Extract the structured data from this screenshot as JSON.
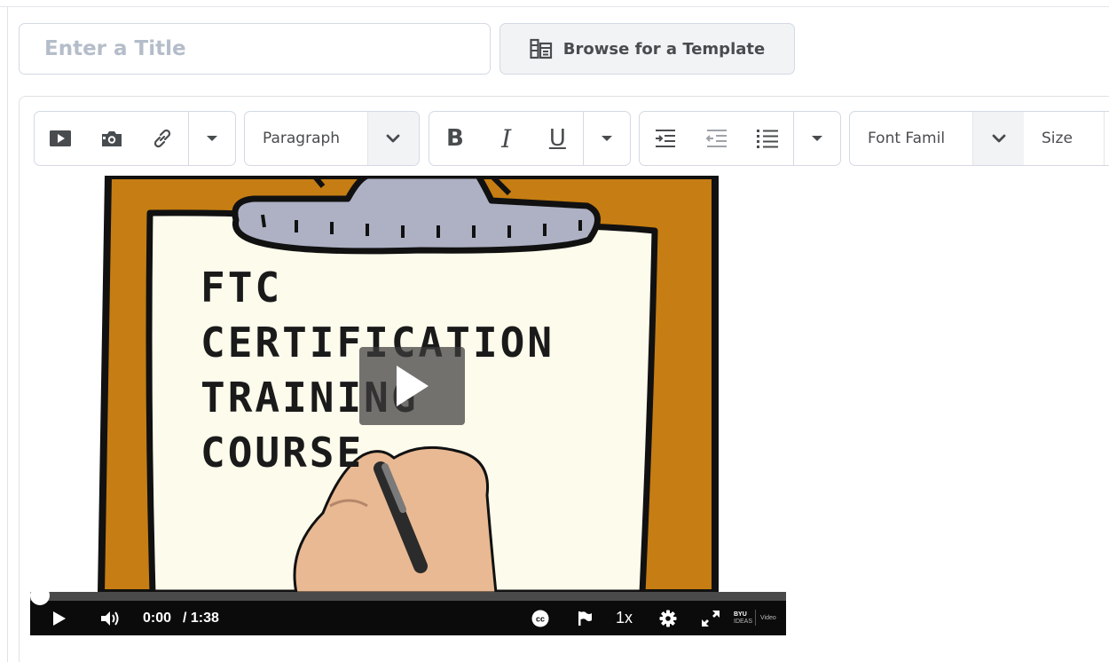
{
  "title_field": {
    "placeholder": "Enter a Title",
    "value": ""
  },
  "template_button": {
    "label": "Browse for a Template",
    "icon": "template-browse-icon"
  },
  "toolbar": {
    "insert_group": [
      {
        "name": "insert-video-icon",
        "label": "Insert Video"
      },
      {
        "name": "insert-image-icon",
        "label": "Insert Image"
      },
      {
        "name": "insert-link-icon",
        "label": "Insert Link"
      },
      {
        "name": "more-dropdown-icon",
        "label": "More"
      }
    ],
    "paragraph": {
      "selected": "Paragraph"
    },
    "format_group": {
      "bold": "B",
      "italic": "I",
      "underline": "U"
    },
    "list_group": [
      {
        "name": "indent-icon"
      },
      {
        "name": "outdent-icon"
      },
      {
        "name": "bulleted-list-icon"
      },
      {
        "name": "list-dropdown-icon"
      }
    ],
    "font_family": {
      "selected": "Font Famil"
    },
    "size": {
      "selected": "Size"
    }
  },
  "video": {
    "board_lines": [
      "FTC",
      "CERTIFICATION",
      "TRAINING",
      "COURSE"
    ],
    "current_time": "0:00",
    "duration": "/ 1:38",
    "progress": 0,
    "speed": "1x",
    "brand_top": "BYU",
    "brand_sub": "IDEAS",
    "brand_text": "Video"
  },
  "colors": {
    "clipboard_orange": "#c67d13",
    "paper": "#fdfbec",
    "clip_gray": "#aeb1c4",
    "controls_bg": "#0b0b0b",
    "button_bg": "#f1f3f5",
    "border": "#d3d9e3"
  }
}
